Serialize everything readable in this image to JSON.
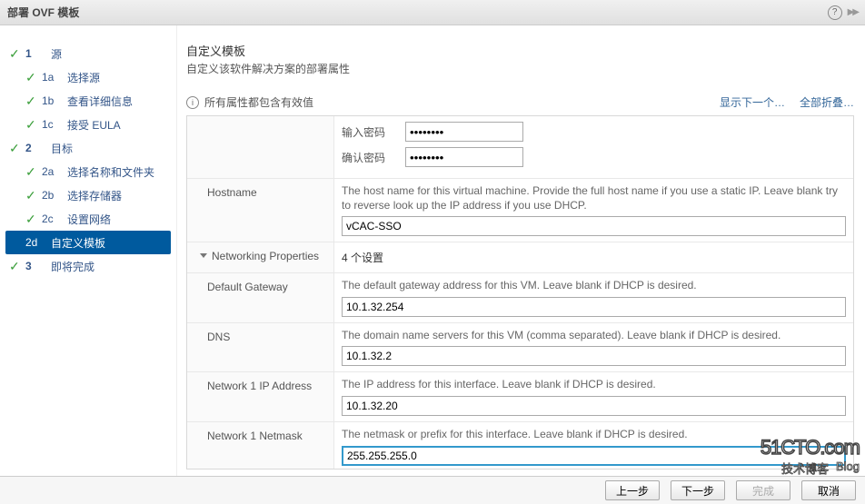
{
  "header": {
    "title": "部署 OVF 模板"
  },
  "sidebar": {
    "steps": [
      {
        "num": "1",
        "label": "源"
      },
      {
        "num": "1a",
        "label": "选择源"
      },
      {
        "num": "1b",
        "label": "查看详细信息"
      },
      {
        "num": "1c",
        "label": "接受 EULA"
      },
      {
        "num": "2",
        "label": "目标"
      },
      {
        "num": "2a",
        "label": "选择名称和文件夹"
      },
      {
        "num": "2b",
        "label": "选择存储器"
      },
      {
        "num": "2c",
        "label": "设置网络"
      },
      {
        "num": "2d",
        "label": "自定义模板"
      },
      {
        "num": "3",
        "label": "即将完成"
      }
    ]
  },
  "content": {
    "title": "自定义模板",
    "subtitle": "自定义该软件解决方案的部署属性",
    "info": "所有属性都包含有效值",
    "link_next": "显示下一个…",
    "link_collapse": "全部折叠…"
  },
  "form": {
    "password": {
      "enter_label": "输入密码",
      "confirm_label": "确认密码",
      "masked": "********"
    },
    "hostname": {
      "label": "Hostname",
      "desc": "The host name for this virtual machine. Provide the full host name if you use a static IP. Leave blank try to reverse look up the IP address if you use DHCP.",
      "value": "vCAC-SSO"
    },
    "net_section": {
      "label": "Networking Properties",
      "count": "4 个设置"
    },
    "gateway": {
      "label": "Default Gateway",
      "desc": "The default gateway address for this VM. Leave blank if DHCP is desired.",
      "value": "10.1.32.254"
    },
    "dns": {
      "label": "DNS",
      "desc": "The domain name servers for this VM (comma separated). Leave blank if DHCP is desired.",
      "value": "10.1.32.2"
    },
    "ip": {
      "label": "Network 1 IP Address",
      "desc": "The IP address for this interface. Leave blank if DHCP is desired.",
      "value": "10.1.32.20"
    },
    "netmask": {
      "label": "Network 1 Netmask",
      "desc": "The netmask or prefix for this interface. Leave blank if DHCP is desired.",
      "value": "255.255.255.0"
    }
  },
  "footer": {
    "back": "上一步",
    "next": "下一步",
    "finish": "完成",
    "cancel": "取消"
  },
  "watermark": {
    "main": "51CTO.com",
    "sub1": "技术博客",
    "sub2": "Blog"
  }
}
